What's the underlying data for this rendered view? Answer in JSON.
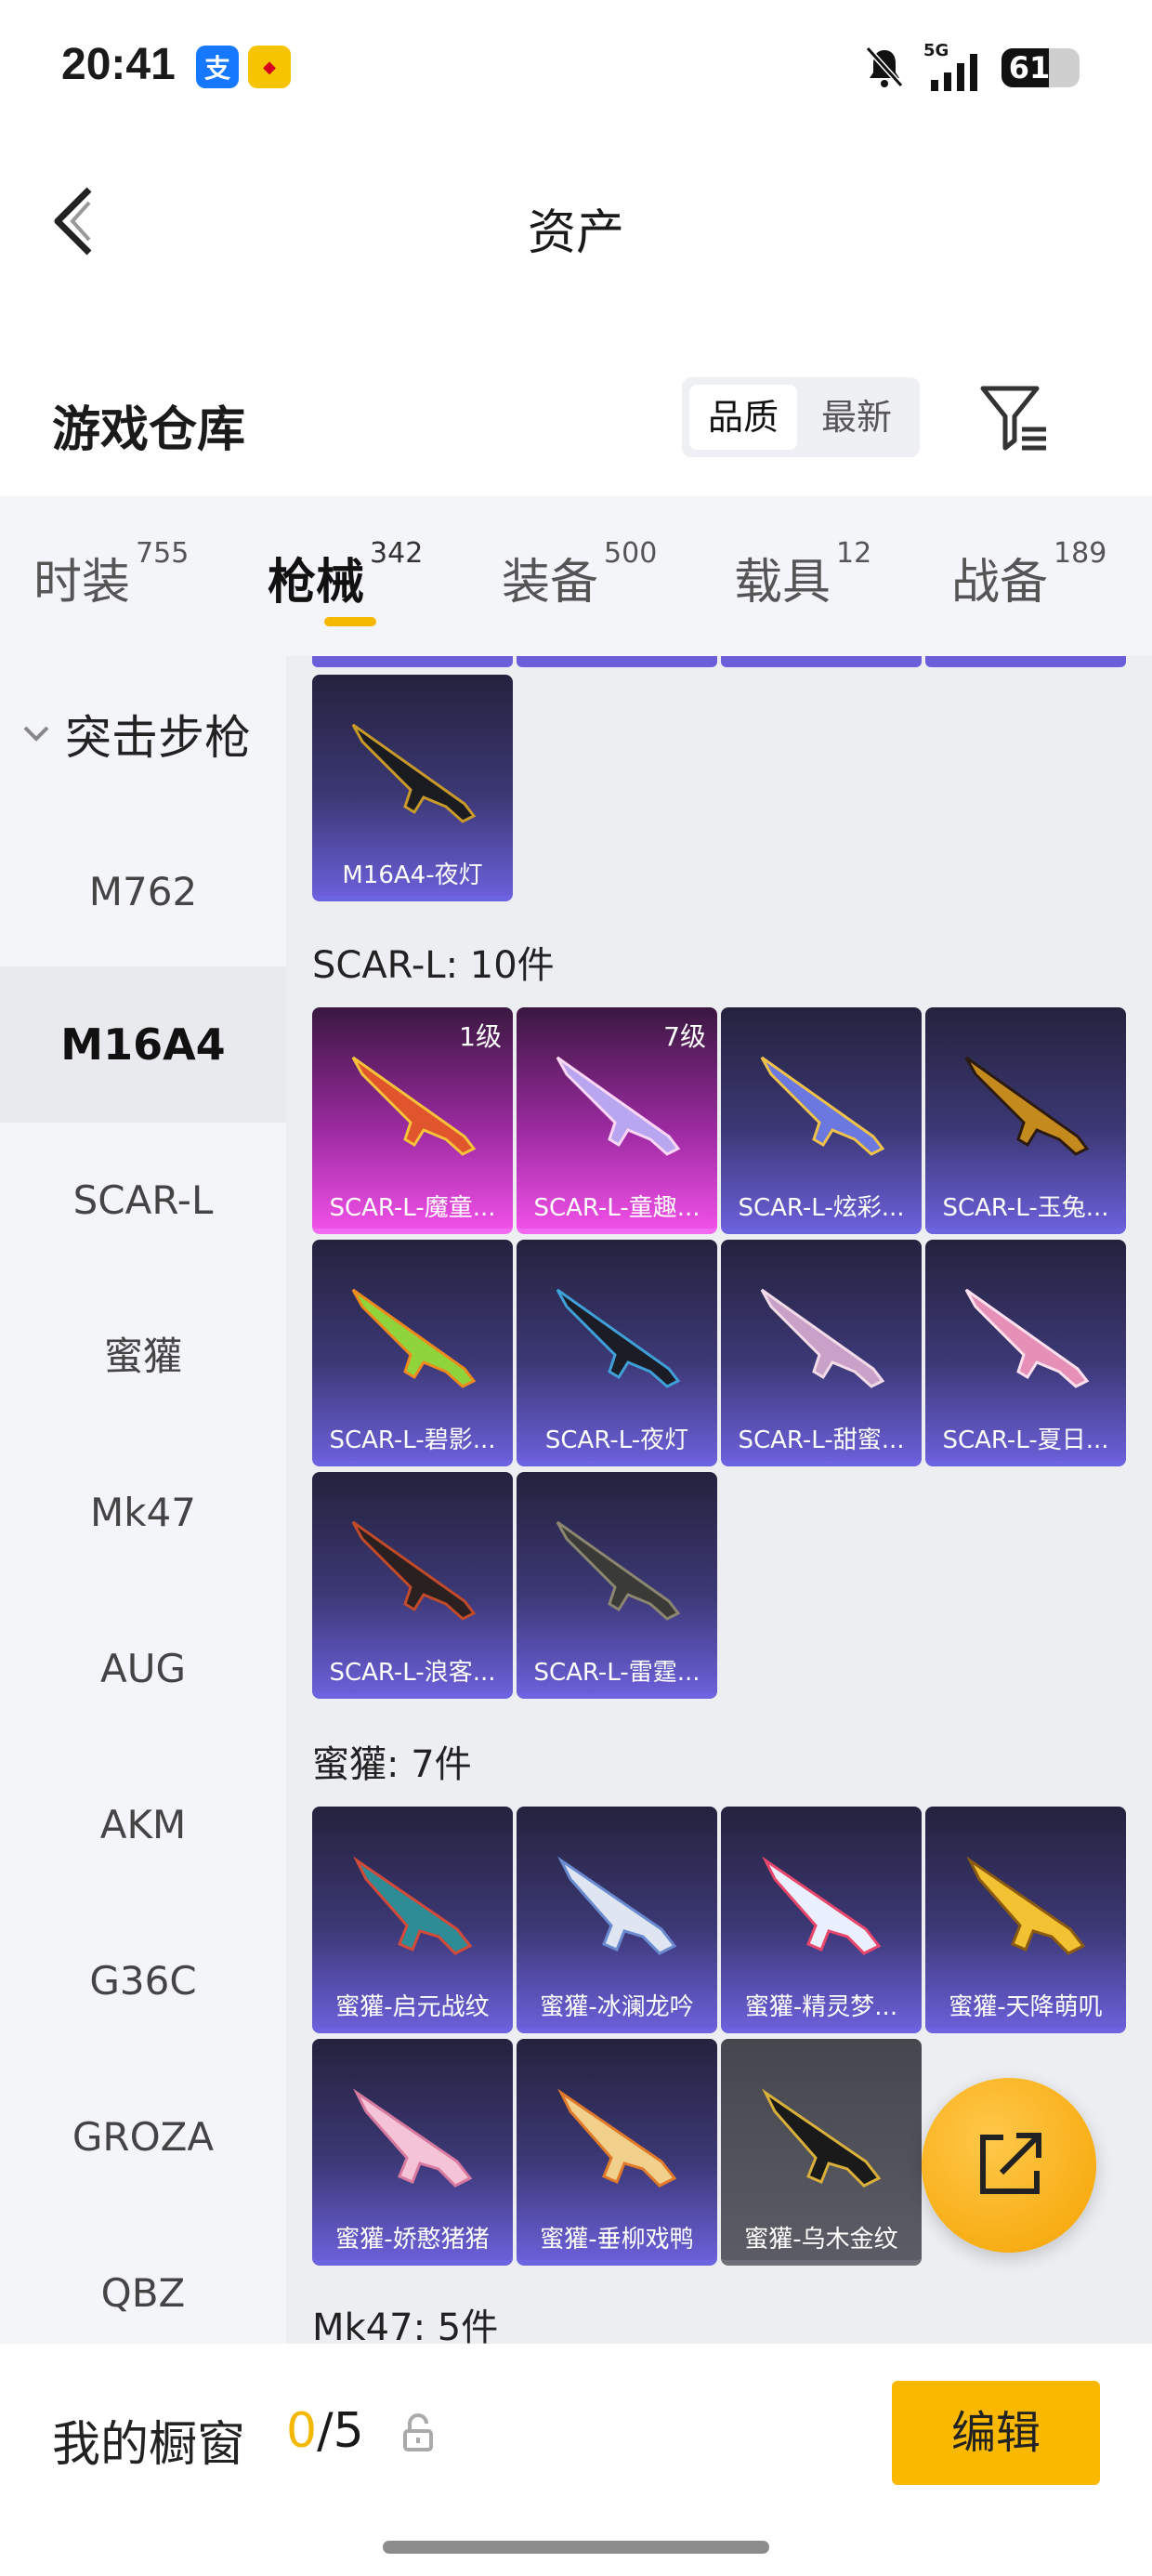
{
  "status_bar": {
    "time": "20:41",
    "network": "5G",
    "battery": "61",
    "battery_level": 0.61,
    "app_icons": [
      "alipay-icon",
      "game-app-icon"
    ]
  },
  "header": {
    "title": "资产"
  },
  "section": {
    "title": "游戏仓库"
  },
  "sort": {
    "options": [
      "品质",
      "最新"
    ],
    "selected": "品质"
  },
  "tabs": [
    {
      "label": "时装",
      "count": "755"
    },
    {
      "label": "枪械",
      "count": "342",
      "active": true
    },
    {
      "label": "装备",
      "count": "500"
    },
    {
      "label": "载具",
      "count": "12"
    },
    {
      "label": "战备",
      "count": "189"
    }
  ],
  "sidenav": {
    "group": "突击步枪",
    "items": [
      "M762",
      "M16A4",
      "SCAR-L",
      "蜜獾",
      "Mk47",
      "AUG",
      "AKM",
      "G36C",
      "GROZA",
      "QBZ"
    ],
    "active": "M16A4"
  },
  "content": {
    "top_item": "M16A4-夜灯",
    "groups": [
      {
        "label": "SCAR-L: 10件",
        "items": [
          {
            "name": "SCAR-L-魔童...",
            "level": "1级",
            "rarity": "pink"
          },
          {
            "name": "SCAR-L-童趣...",
            "level": "7级",
            "rarity": "pink"
          },
          {
            "name": "SCAR-L-炫彩...",
            "rarity": "purple"
          },
          {
            "name": "SCAR-L-玉兔...",
            "rarity": "purple"
          },
          {
            "name": "SCAR-L-碧影...",
            "rarity": "purple"
          },
          {
            "name": "SCAR-L-夜灯",
            "rarity": "purple"
          },
          {
            "name": "SCAR-L-甜蜜...",
            "rarity": "purple"
          },
          {
            "name": "SCAR-L-夏日...",
            "rarity": "purple"
          },
          {
            "name": "SCAR-L-浪客...",
            "rarity": "purple"
          },
          {
            "name": "SCAR-L-雷霆...",
            "rarity": "purple"
          }
        ]
      },
      {
        "label": "蜜獾: 7件",
        "items": [
          {
            "name": "蜜獾-启元战纹",
            "rarity": "purple"
          },
          {
            "name": "蜜獾-冰澜龙吟",
            "rarity": "purple"
          },
          {
            "name": "蜜獾-精灵梦...",
            "rarity": "purple"
          },
          {
            "name": "蜜獾-天降萌叽",
            "rarity": "purple"
          },
          {
            "name": "蜜獾-娇憨猪猪",
            "rarity": "purple"
          },
          {
            "name": "蜜獾-垂柳戏鸭",
            "rarity": "purple"
          },
          {
            "name": "蜜獾-乌木金纹",
            "rarity": "gray"
          }
        ]
      },
      {
        "label": "Mk47: 5件",
        "items": []
      }
    ]
  },
  "showcase": {
    "label": "我的橱窗",
    "current": "0",
    "total": "/5"
  },
  "actions": {
    "edit": "编辑"
  },
  "colors": {
    "accent": "#f5b800",
    "purple_card": "#6a5fd8",
    "pink_card": "#ef4fe6"
  }
}
